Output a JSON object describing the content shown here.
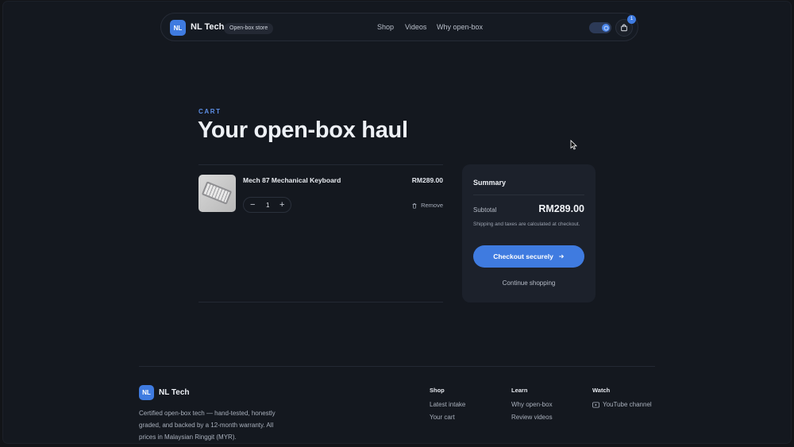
{
  "nav": {
    "logo": "NL",
    "brand": "NL Tech",
    "store_pill": "Open-box store",
    "links": [
      "Shop",
      "Videos",
      "Why open-box"
    ],
    "cart_count": "1"
  },
  "header": {
    "eyebrow": "CART",
    "title": "Your open-box haul"
  },
  "cart": {
    "items": [
      {
        "name": "Mech 87 Mechanical Keyboard",
        "price": "RM289.00",
        "quantity": "1",
        "remove_label": "Remove"
      }
    ]
  },
  "summary": {
    "title": "Summary",
    "subtotal_label": "Subtotal",
    "subtotal_value": "RM289.00",
    "note": "Shipping and taxes are calculated at checkout.",
    "checkout_label": "Checkout securely",
    "continue_label": "Continue shopping"
  },
  "footer": {
    "logo": "NL",
    "brand": "NL Tech",
    "description": "Certified open-box tech — hand-tested, honestly graded, and backed by a 12-month warranty. All prices in Malaysian Ringgit (MYR).",
    "columns": [
      {
        "heading": "Shop",
        "items": [
          "Latest intake",
          "Your cart"
        ]
      },
      {
        "heading": "Learn",
        "items": [
          "Why open-box",
          "Review videos"
        ]
      },
      {
        "heading": "Watch",
        "items": [
          "YouTube channel"
        ]
      }
    ]
  },
  "colors": {
    "accent": "#3f7be0",
    "background": "#14181f",
    "card": "#1c212b"
  }
}
